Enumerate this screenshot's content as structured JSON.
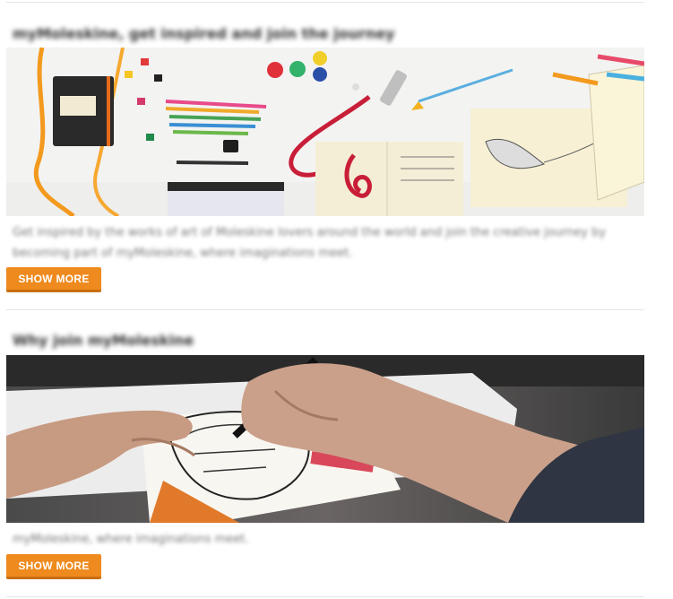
{
  "sections": [
    {
      "title": "myMoleskine, get inspired and join the journey",
      "description": "Get inspired by the works of art of Moleskine lovers around the world and join the creative journey by becoming part of myMoleskine, where imaginations meet.",
      "button_label": "SHOW MORE"
    },
    {
      "title": "Why join myMoleskine",
      "description": "myMoleskine, where imaginations meet.",
      "button_label": "SHOW MORE"
    }
  ],
  "colors": {
    "accent": "#ee8a1e",
    "divider": "#e6e6e6"
  }
}
